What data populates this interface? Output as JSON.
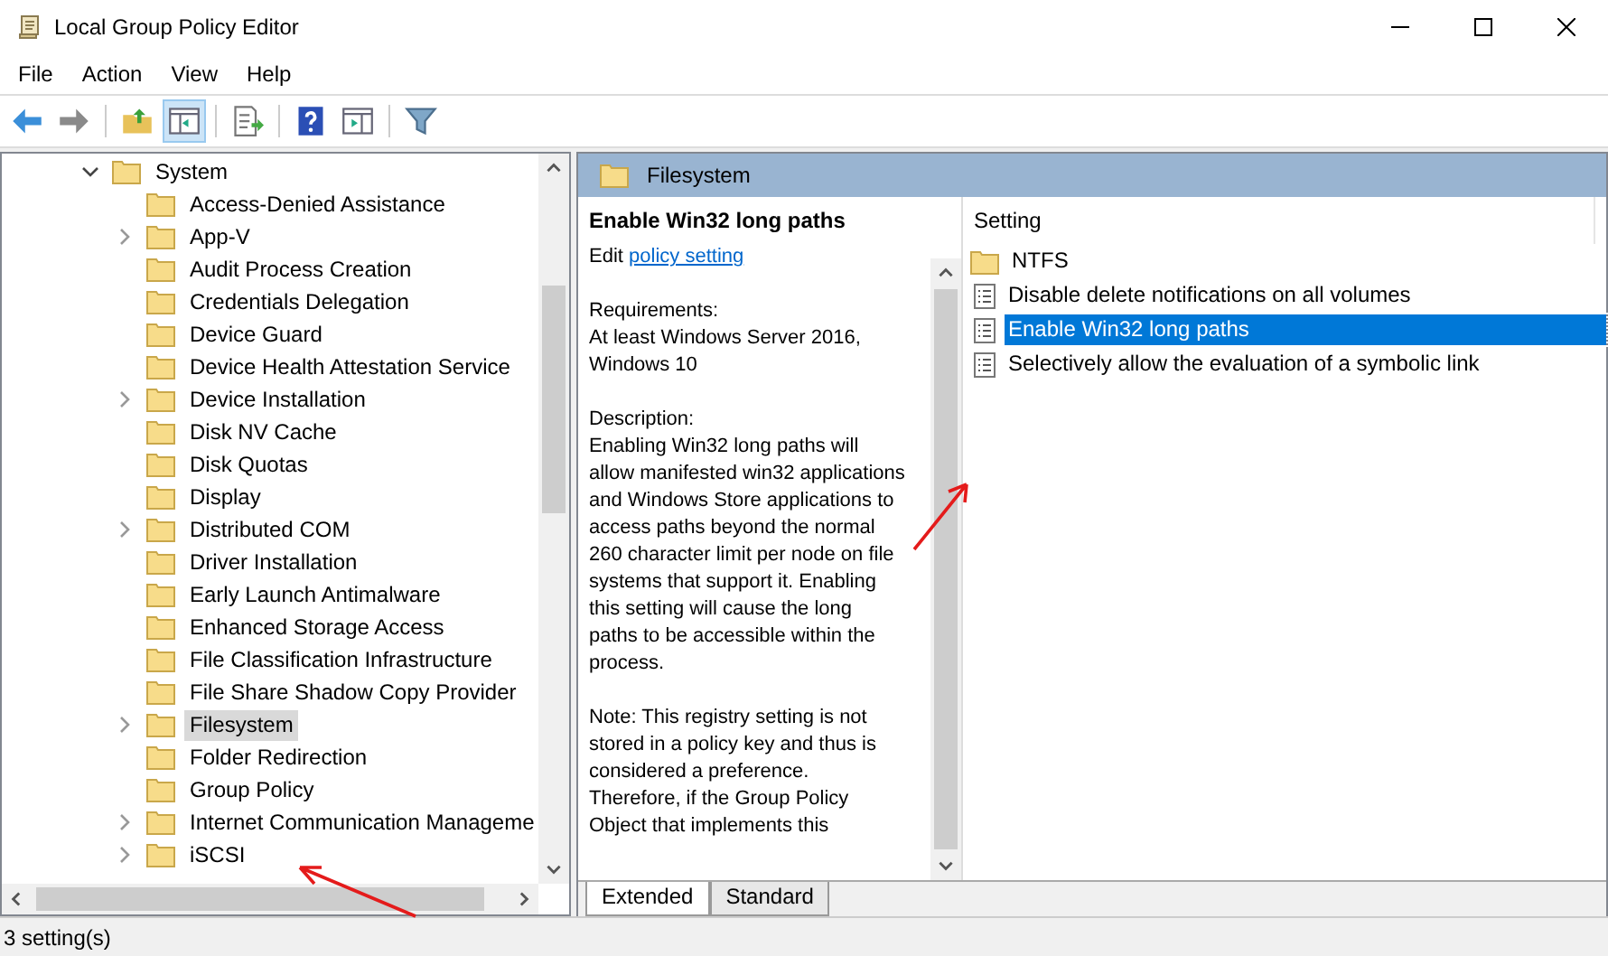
{
  "window": {
    "title": "Local Group Policy Editor"
  },
  "menu": [
    "File",
    "Action",
    "View",
    "Help"
  ],
  "tree": [
    {
      "label": "System",
      "expandable": true,
      "expanded": true,
      "selected": false,
      "children": [
        {
          "label": "Access-Denied Assistance",
          "expandable": false,
          "selected": false
        },
        {
          "label": "App-V",
          "expandable": true,
          "selected": false
        },
        {
          "label": "Audit Process Creation",
          "expandable": false,
          "selected": false
        },
        {
          "label": "Credentials Delegation",
          "expandable": false,
          "selected": false
        },
        {
          "label": "Device Guard",
          "expandable": false,
          "selected": false
        },
        {
          "label": "Device Health Attestation Service",
          "expandable": false,
          "selected": false
        },
        {
          "label": "Device Installation",
          "expandable": true,
          "selected": false
        },
        {
          "label": "Disk NV Cache",
          "expandable": false,
          "selected": false
        },
        {
          "label": "Disk Quotas",
          "expandable": false,
          "selected": false
        },
        {
          "label": "Display",
          "expandable": false,
          "selected": false
        },
        {
          "label": "Distributed COM",
          "expandable": true,
          "selected": false
        },
        {
          "label": "Driver Installation",
          "expandable": false,
          "selected": false
        },
        {
          "label": "Early Launch Antimalware",
          "expandable": false,
          "selected": false
        },
        {
          "label": "Enhanced Storage Access",
          "expandable": false,
          "selected": false
        },
        {
          "label": "File Classification Infrastructure",
          "expandable": false,
          "selected": false
        },
        {
          "label": "File Share Shadow Copy Provider",
          "expandable": false,
          "selected": false
        },
        {
          "label": "Filesystem",
          "expandable": true,
          "selected": true
        },
        {
          "label": "Folder Redirection",
          "expandable": false,
          "selected": false
        },
        {
          "label": "Group Policy",
          "expandable": false,
          "selected": false
        },
        {
          "label": "Internet Communication Manageme",
          "expandable": true,
          "selected": false
        },
        {
          "label": "iSCSI",
          "expandable": true,
          "selected": false
        }
      ]
    }
  ],
  "pane_header": "Filesystem",
  "details": {
    "title": "Enable Win32 long paths",
    "edit_prefix": "Edit",
    "edit_link": "policy setting",
    "requirements_label": "Requirements:",
    "requirements": "At least Windows Server 2016, Windows 10",
    "description_label": "Description:",
    "description": "Enabling Win32 long paths will allow manifested win32 applications and Windows Store applications to access paths beyond the normal 260 character limit per node on file systems that support it.  Enabling this setting will cause the long paths to be accessible within the process.",
    "note": "Note:  This registry setting is not stored in a policy key and thus is considered a preference. Therefore, if the Group Policy Object that implements this"
  },
  "settings": {
    "column": "Setting",
    "rows": [
      {
        "kind": "folder",
        "label": "NTFS",
        "selected": false
      },
      {
        "kind": "setting",
        "label": "Disable delete notifications on all volumes",
        "selected": false
      },
      {
        "kind": "setting",
        "label": "Enable Win32 long paths",
        "selected": true
      },
      {
        "kind": "setting",
        "label": "Selectively allow the evaluation of a symbolic link",
        "selected": false
      }
    ]
  },
  "tabs": [
    {
      "label": "Extended",
      "selected": true
    },
    {
      "label": "Standard",
      "selected": false
    }
  ],
  "status_bar": "3 setting(s)"
}
